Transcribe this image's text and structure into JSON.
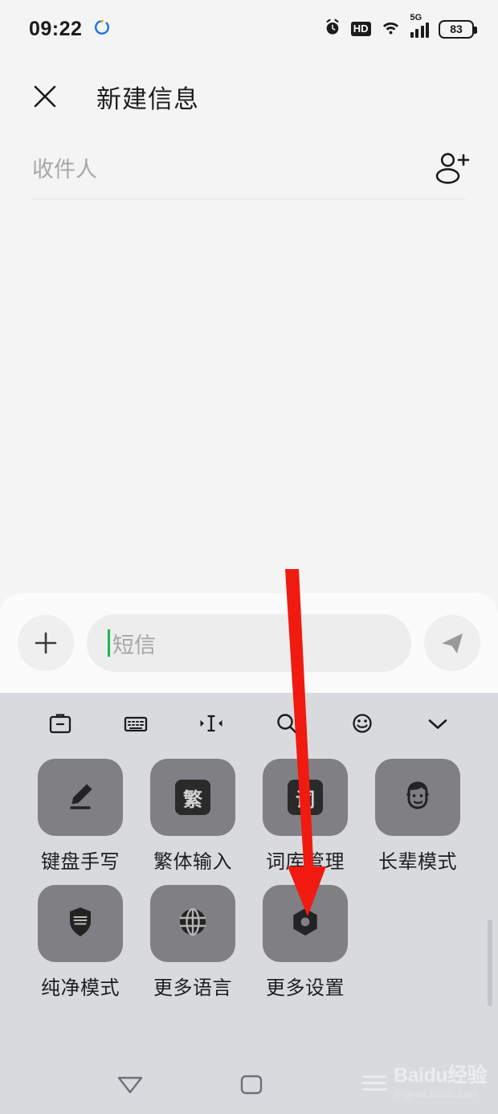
{
  "status_bar": {
    "time": "09:22",
    "alarm_icon": "alarm-clock-icon",
    "hd_label": "HD",
    "wifi_icon": "wifi-icon",
    "network_label": "5G",
    "signal_icon": "signal-bars-icon",
    "battery_level": "83"
  },
  "app_bar": {
    "close_icon": "close-icon",
    "title": "新建信息"
  },
  "recipient": {
    "placeholder": "收件人",
    "value": "",
    "add_contact_icon": "add-contact-icon"
  },
  "composer": {
    "attach_icon": "plus-icon",
    "message_placeholder": "短信",
    "message_value": "",
    "send_icon": "send-icon"
  },
  "keyboard_toolbar": {
    "items": [
      {
        "icon": "clipboard-icon",
        "name": "clipboard"
      },
      {
        "icon": "keyboard-icon",
        "name": "keyboard"
      },
      {
        "icon": "cursor-move-icon",
        "name": "cursor-move"
      },
      {
        "icon": "search-icon",
        "name": "search"
      },
      {
        "icon": "emoji-icon",
        "name": "emoji"
      },
      {
        "icon": "chevron-down-icon",
        "name": "collapse"
      }
    ]
  },
  "keyboard_tiles": {
    "row1": [
      {
        "label": "键盘手写",
        "icon": "pencil-icon"
      },
      {
        "label": "繁体输入",
        "icon": "traditional-chinese-icon",
        "glyph": "繁"
      },
      {
        "label": "词库管理",
        "icon": "dictionary-icon",
        "glyph": "词"
      },
      {
        "label": "长辈模式",
        "icon": "elder-face-icon"
      }
    ],
    "row2": [
      {
        "label": "纯净模式",
        "icon": "shield-keyboard-icon"
      },
      {
        "label": "更多语言",
        "icon": "globe-icon"
      },
      {
        "label": "更多设置",
        "icon": "settings-nut-icon"
      }
    ]
  },
  "nav_bar": {
    "back_icon": "back-triangle-icon",
    "home_icon": "home-square-icon"
  },
  "watermark": {
    "brand": "Baidu经验",
    "url": "jingyan.baidu.com"
  },
  "annotation": {
    "arrow_color": "#f01a11",
    "points_to": "更多设置"
  },
  "colors": {
    "page_background": "#f4f4f4",
    "keyboard_background": "#d8dade",
    "tile_background": "#807f83",
    "accent_caret": "#21b54a",
    "arrow_red": "#f01a11"
  }
}
